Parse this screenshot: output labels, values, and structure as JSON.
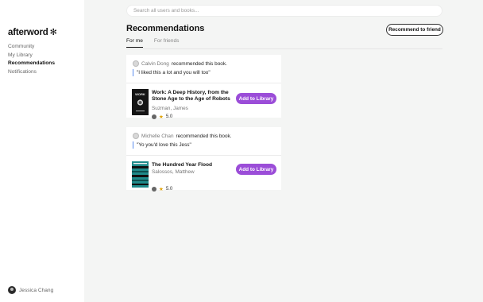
{
  "sidebar": {
    "logo": "afterword",
    "logo_mark": "✻",
    "items": [
      {
        "label": "Community"
      },
      {
        "label": "My Library"
      },
      {
        "label": "Recommendations"
      },
      {
        "label": "Notifications"
      }
    ],
    "user": "Jessica Chang"
  },
  "search": {
    "placeholder": "Search all users and books..."
  },
  "header": {
    "title": "Recommendations",
    "recommend_button": "Recommend to friend"
  },
  "tabs": [
    {
      "label": "For me",
      "active": true
    },
    {
      "label": "For friends",
      "active": false
    }
  ],
  "recommendations": [
    {
      "recommender": "Calvin Dong",
      "action": "recommended this book.",
      "quote": "\"I liked this a lot and you will too\"",
      "book": {
        "title": "Work: A Deep History, from the Stone Age to the Age of Robots",
        "author": "Suzman, James",
        "rating": "5.0",
        "cover_text": "WORK"
      },
      "add_label": "Add to Library"
    },
    {
      "recommender": "Michelle Chan",
      "action": "recommended this book.",
      "quote": "\"Yo you'd love this Jess\"",
      "book": {
        "title": "The Hundred Year Flood",
        "author": "Salossos, Matthew",
        "rating": "5.0"
      },
      "add_label": "Add to Library"
    }
  ],
  "colors": {
    "accent": "#9b4dd8",
    "quote_bar": "#5b8def",
    "star": "#e0a100"
  }
}
